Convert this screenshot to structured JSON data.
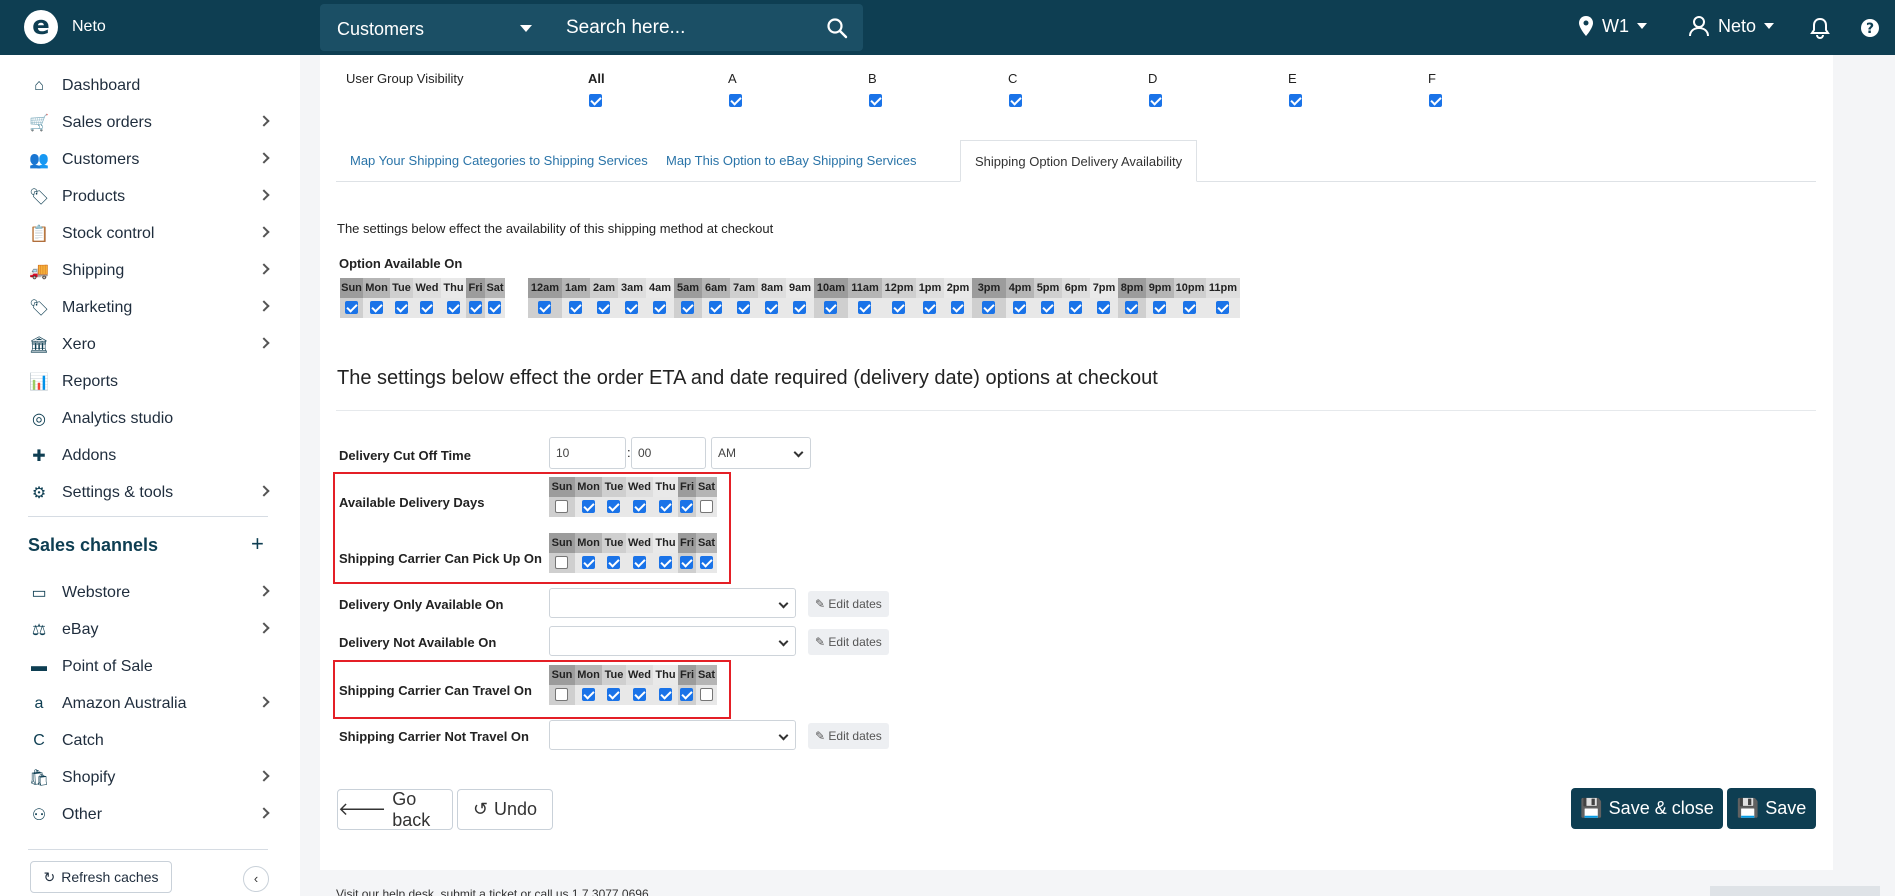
{
  "topbar": {
    "brand_name": "Neto",
    "search_category": "Customers",
    "search_placeholder": "Search here...",
    "warehouse": "W1",
    "user": "Neto"
  },
  "sidebar": {
    "items": [
      {
        "label": "Dashboard",
        "icon": "home-icon",
        "chevron": false
      },
      {
        "label": "Sales orders",
        "icon": "sales-orders-icon",
        "chevron": true
      },
      {
        "label": "Customers",
        "icon": "customers-icon",
        "chevron": true
      },
      {
        "label": "Products",
        "icon": "products-icon",
        "chevron": true
      },
      {
        "label": "Stock control",
        "icon": "stock-control-icon",
        "chevron": true
      },
      {
        "label": "Shipping",
        "icon": "shipping-icon",
        "chevron": true
      },
      {
        "label": "Marketing",
        "icon": "marketing-icon",
        "chevron": true
      },
      {
        "label": "Xero",
        "icon": "xero-icon",
        "chevron": true
      },
      {
        "label": "Reports",
        "icon": "reports-icon",
        "chevron": false
      },
      {
        "label": "Analytics studio",
        "icon": "analytics-icon",
        "chevron": false
      },
      {
        "label": "Addons",
        "icon": "addons-icon",
        "chevron": false
      },
      {
        "label": "Settings & tools",
        "icon": "settings-icon",
        "chevron": true
      }
    ],
    "sales_channels_heading": "Sales channels",
    "channels": [
      {
        "label": "Webstore",
        "icon": "webstore-icon",
        "chevron": true
      },
      {
        "label": "eBay",
        "icon": "ebay-icon",
        "chevron": true
      },
      {
        "label": "Point of Sale",
        "icon": "point-of-sale-icon",
        "chevron": false
      },
      {
        "label": "Amazon Australia",
        "icon": "amazon-icon",
        "chevron": true
      },
      {
        "label": "Catch",
        "icon": "catch-icon",
        "chevron": false
      },
      {
        "label": "Shopify",
        "icon": "shopify-icon",
        "chevron": true
      },
      {
        "label": "Other",
        "icon": "other-icon",
        "chevron": true
      }
    ],
    "refresh_label": "Refresh caches"
  },
  "user_group": {
    "label": "User Group Visibility",
    "groups": [
      {
        "label": "All",
        "checked": true
      },
      {
        "label": "A",
        "checked": true
      },
      {
        "label": "B",
        "checked": true
      },
      {
        "label": "C",
        "checked": true
      },
      {
        "label": "D",
        "checked": true
      },
      {
        "label": "E",
        "checked": true
      },
      {
        "label": "F",
        "checked": true
      }
    ]
  },
  "tabs": [
    {
      "label": "Map Your Shipping Categories to Shipping Services",
      "active": false
    },
    {
      "label": "Map This Option to eBay Shipping Services",
      "active": false
    },
    {
      "label": "Shipping Option Delivery Availability",
      "active": true
    }
  ],
  "availability": {
    "intro": "The settings below effect the availability of this shipping method at checkout",
    "option_label": "Option Available On",
    "days": [
      "Sun",
      "Mon",
      "Tue",
      "Wed",
      "Thu",
      "Fri",
      "Sat"
    ],
    "hours": [
      "12am",
      "1am",
      "2am",
      "3am",
      "4am",
      "5am",
      "6am",
      "7am",
      "8am",
      "9am",
      "10am",
      "11am",
      "12pm",
      "1pm",
      "2pm",
      "3pm",
      "4pm",
      "5pm",
      "6pm",
      "7pm",
      "8pm",
      "9pm",
      "10pm",
      "11pm"
    ]
  },
  "eta": {
    "heading": "The settings below effect the order ETA and date required (delivery date) options at checkout",
    "cutoff_label": "Delivery Cut Off Time",
    "cutoff_hour": "10",
    "cutoff_sep": ":",
    "cutoff_min": "00",
    "cutoff_ampm": "AM",
    "available_delivery_label": "Available Delivery Days",
    "available_delivery_checks": [
      false,
      true,
      true,
      true,
      true,
      true,
      false
    ],
    "pickup_label": "Shipping Carrier Can Pick Up On",
    "pickup_checks": [
      false,
      true,
      true,
      true,
      true,
      true,
      true
    ],
    "only_available_label": "Delivery Only Available On",
    "not_available_label": "Delivery Not Available On",
    "travel_label": "Shipping Carrier Can Travel On",
    "travel_checks": [
      false,
      true,
      true,
      true,
      true,
      true,
      false
    ],
    "not_travel_label": "Shipping Carrier Not Travel On",
    "edit_dates": "Edit dates"
  },
  "actions": {
    "go_back": "Go back",
    "undo": "Undo",
    "save_close": "Save & close",
    "save": "Save"
  },
  "footer": {
    "text": "Visit our help desk, submit a ticket or call us 1 7 3077 0696"
  }
}
